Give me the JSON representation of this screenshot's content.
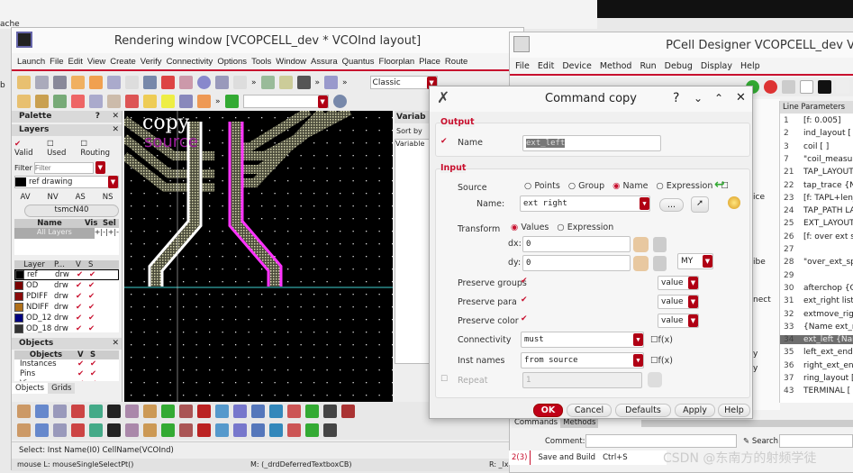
{
  "background": {
    "left_text_1": "ache",
    "left_text_2": "b"
  },
  "render": {
    "title": "Rendering window [VCOPCELL_dev * VCOInd layout]",
    "menu": [
      "Launch",
      "File",
      "Edit",
      "View",
      "Create",
      "Verify",
      "Connectivity",
      "Options",
      "Tools",
      "Window",
      "Assura",
      "Quantus",
      "Floorplan",
      "Place",
      "Route"
    ],
    "style_select": "Classic",
    "more": "»",
    "palette": {
      "title": "Palette",
      "help": "?",
      "layers_title": "Layers",
      "valid": "Valid",
      "used": "Used",
      "routing": "Routing",
      "filter_label": "Filter",
      "filter_placeholder": "Filter",
      "current_layer": "ref drawing",
      "av": "AV",
      "nv": "NV",
      "as": "AS",
      "ns": "NS",
      "tech": "tsmcN40",
      "cols": [
        "Name",
        "Vis",
        "Sel"
      ],
      "all_layers": "All Layers",
      "pm": [
        "+",
        "-",
        "+",
        "-"
      ],
      "layer_cols": [
        "Layer",
        "P...",
        "V",
        "S"
      ],
      "layers": [
        {
          "name": "ref",
          "p": "drw",
          "color": "#000000"
        },
        {
          "name": "OD",
          "p": "drw",
          "color": "#7a0000"
        },
        {
          "name": "PDIFF",
          "p": "drw",
          "color": "#8a0a0a"
        },
        {
          "name": "NDIFF",
          "p": "drw",
          "color": "#b0701a"
        },
        {
          "name": "OD_12",
          "p": "drw",
          "color": "#000080"
        },
        {
          "name": "OD_18",
          "p": "drw",
          "color": "#333333"
        }
      ],
      "objects_title": "Objects",
      "objects_cols": [
        "Objects",
        "V",
        "S"
      ],
      "objects": [
        "Instances",
        "Pins",
        "Vias"
      ],
      "tabs": [
        "Objects",
        "Grids"
      ]
    },
    "canvas": {
      "label_copy": "copy",
      "label_source": "source"
    },
    "variables": {
      "title": "Variab",
      "sort_by": "Sort by",
      "col": "Variable"
    },
    "status_select": "Select:  Inst  Name(I0)  CellName(VCOInd)",
    "mouse_l": "mouse L: mouseSingleSelectPt()",
    "mouse_m": "M: (_drdDeferredTextboxCB)",
    "mouse_r": "R: _lx"
  },
  "pcell": {
    "title": "PCell Designer VCOPCELL_dev V",
    "menu": [
      "File",
      "Edit",
      "Device",
      "Method",
      "Run",
      "Debug",
      "Display",
      "Help"
    ],
    "cols": [
      "Line",
      "Parameters"
    ],
    "side": [
      "ice",
      "ibe",
      "nect",
      "y",
      "y"
    ],
    "rows": [
      [
        "1",
        "[f: 0.005]"
      ],
      [
        "2",
        "ind_layout [ ]"
      ],
      [
        "3",
        "coil [ ]"
      ],
      [
        "7",
        "\"coil_measure"
      ],
      [
        "21",
        "TAP_LAYOUT ["
      ],
      [
        "22",
        "tap_trace {Nam"
      ],
      [
        "23",
        "[f: TAPL+len_i"
      ],
      [
        "24",
        "TAP_PATH LAY"
      ],
      [
        "25",
        "EXT_LAYOUT ["
      ],
      [
        "26",
        "[f: over ext sp"
      ],
      [
        "27",
        ""
      ],
      [
        "28",
        "\"over_ext_spa"
      ],
      [
        "29",
        ""
      ],
      [
        "30",
        "afterchop {Gr"
      ],
      [
        "31",
        "ext_right list(L"
      ],
      [
        "32",
        "extmove_righ"
      ],
      [
        "33",
        "{Name ext_rig"
      ],
      [
        "34",
        "ext_left {Nam"
      ],
      [
        "35",
        "left_ext_end {"
      ],
      [
        "36",
        "right_ext_end"
      ],
      [
        "37",
        "ring_layout [ ]"
      ],
      [
        "43",
        "TERMINAL [ ]"
      ]
    ],
    "selected_line": "34",
    "tabs": [
      "Commands",
      "Methods"
    ],
    "comment_label": "Comment:",
    "search_label": "Search:",
    "history_idx": "2(3)",
    "history_cmd": "Save and Build",
    "history_key": "Ctrl+S",
    "watermark": "CSDN @东南方的射频学徒"
  },
  "dialog": {
    "title": "Command copy",
    "help": "?",
    "output": "Output",
    "name_label": "Name",
    "name_value": "ext_left",
    "input": "Input",
    "source_label": "Source",
    "source_opts": [
      "Points",
      "Group",
      "Name",
      "Expression"
    ],
    "source_selected": "Name",
    "name2_label": "Name:",
    "name2_value": "ext right",
    "browse": "...",
    "transform_label": "Transform",
    "transform_opts": [
      "Values",
      "Expression"
    ],
    "transform_selected": "Values",
    "dx_label": "dx:",
    "dx": "0",
    "dy_label": "dy:",
    "dy": "0",
    "mirror": "MY",
    "pg_label": "Preserve groups",
    "pp_label": "Preserve para",
    "pc_label": "Preserve color",
    "value": "value",
    "conn_label": "Connectivity",
    "conn": "must",
    "fx": "f(x)",
    "inst_label": "Inst names",
    "inst": "from source",
    "repeat_label": "Repeat",
    "repeat": "1",
    "buttons": {
      "ok": "OK",
      "cancel": "Cancel",
      "defaults": "Defaults",
      "apply": "Apply",
      "help": "Help"
    }
  },
  "colors": {
    "accent": "#c8102e",
    "canvas": "#000000",
    "highlight": "#ff33ff",
    "selected_row": "#6e6e6e"
  }
}
